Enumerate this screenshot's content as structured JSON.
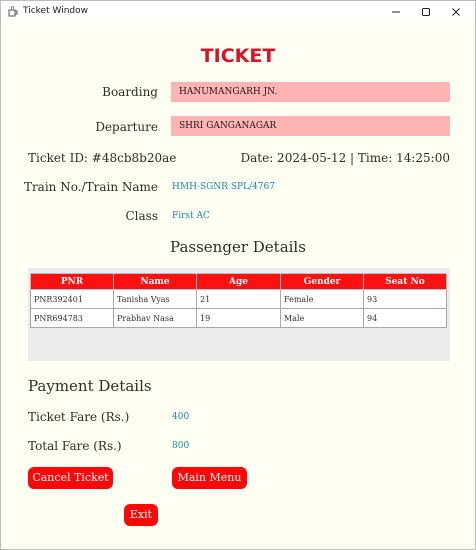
{
  "window": {
    "title": "Ticket Window"
  },
  "heading": "TICKET",
  "boarding": {
    "label": "Boarding",
    "value": "HANUMANGARH JN."
  },
  "departure": {
    "label": "Departure",
    "value": "SHRI GANGANAGAR"
  },
  "ticket_id": "Ticket ID: #48cb8b20ae",
  "datetime": "Date: 2024-05-12 | Time: 14:25:00",
  "train": {
    "label": "Train No./Train Name",
    "value": "HMH-SGNR SPL/4767"
  },
  "class": {
    "label": "Class",
    "value": "First AC"
  },
  "passenger_title": "Passenger Details",
  "passengers": {
    "headers": [
      "PNR",
      "Name",
      "Age",
      "Gender",
      "Seat No"
    ],
    "rows": [
      [
        "PNR392401",
        "Tanisha Vyas",
        "21",
        "Female",
        "93"
      ],
      [
        "PNR694783",
        "Prabhav Nasa",
        "19",
        "Male",
        "94"
      ]
    ]
  },
  "payment_title": "Payment Details",
  "ticket_fare": {
    "label": "Ticket Fare (Rs.)",
    "value": "400"
  },
  "total_fare": {
    "label": "Total Fare (Rs.)",
    "value": "800"
  },
  "buttons": {
    "cancel": "Cancel Ticket",
    "main_menu": "Main Menu",
    "exit": "Exit"
  },
  "colors": {
    "accent_red": "#ff0707",
    "title_red": "#d8142b",
    "field_pink": "#ffb3b3",
    "value_teal": "#1a8ca6",
    "background": "#fefef2"
  }
}
